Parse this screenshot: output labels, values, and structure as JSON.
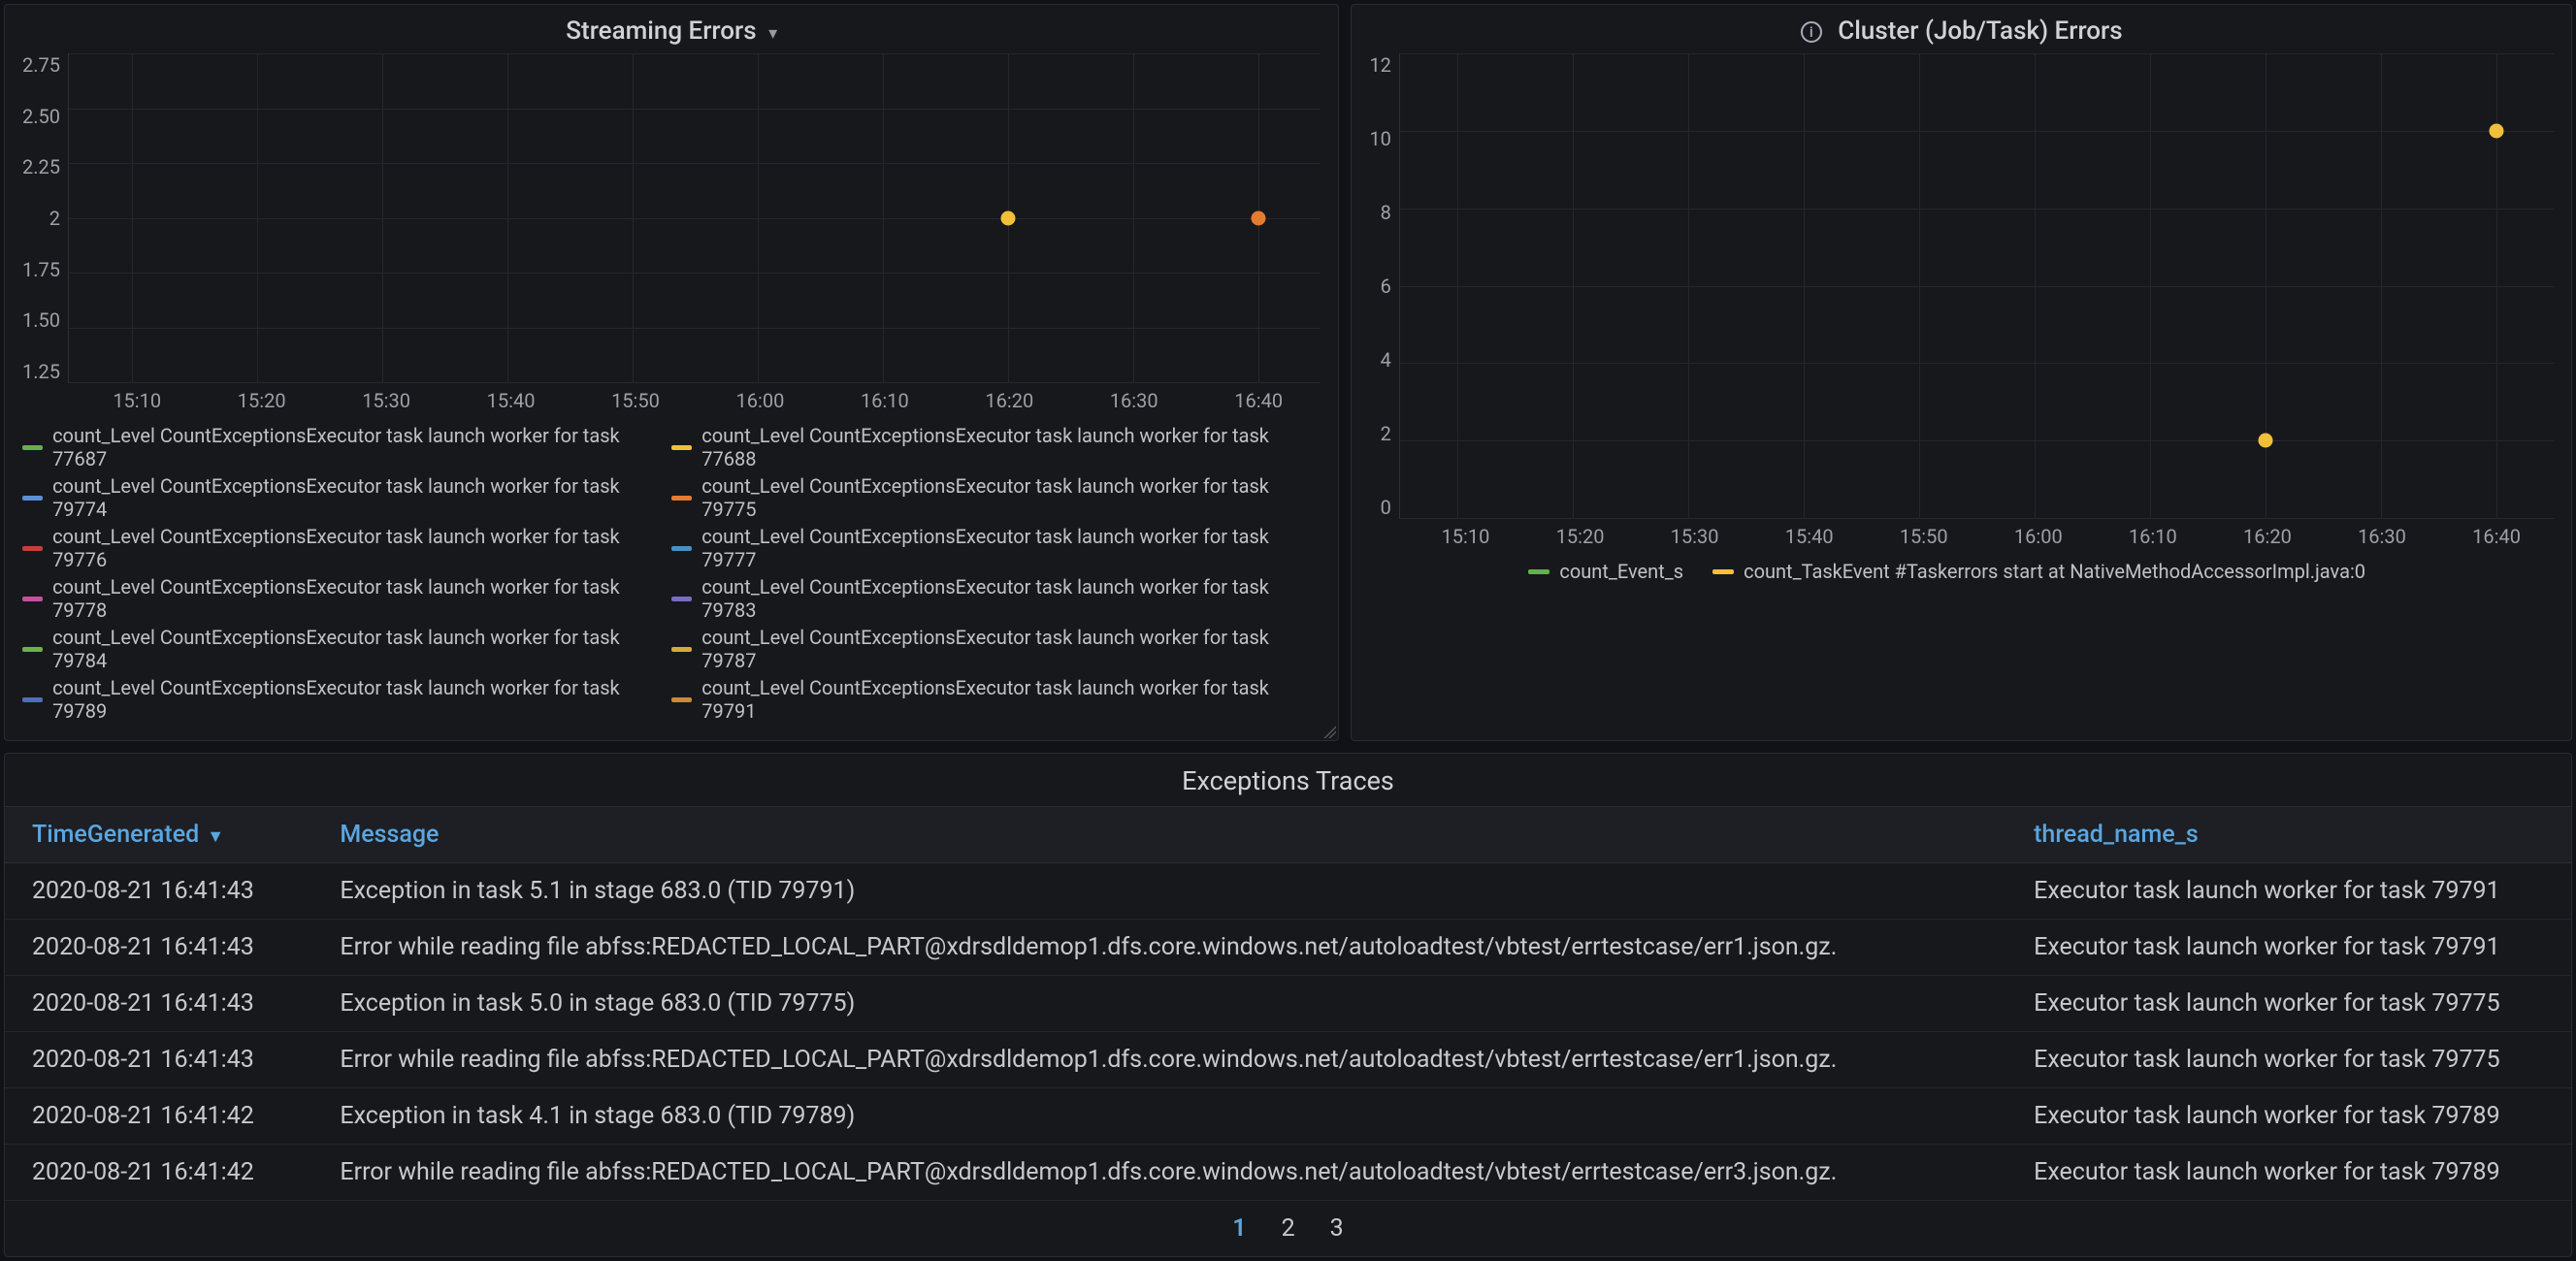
{
  "chart_data": [
    {
      "id": "streaming",
      "type": "scatter",
      "title": "Streaming Errors",
      "xlabel": "",
      "ylabel": "",
      "ylim": [
        1.25,
        2.75
      ],
      "yticks": [
        1.25,
        1.5,
        1.75,
        2.0,
        2.25,
        2.5,
        2.75
      ],
      "xticks": [
        "15:10",
        "15:20",
        "15:30",
        "15:40",
        "15:50",
        "16:00",
        "16:10",
        "16:20",
        "16:30",
        "16:40"
      ],
      "points": [
        {
          "x": "16:20",
          "y": 2.0,
          "color": "#f2c038"
        },
        {
          "x": "16:40",
          "y": 2.0,
          "color": "#e57b2f"
        }
      ],
      "series": [
        {
          "name": "count_Level CountExceptionsExecutor task launch worker for task 77687",
          "color": "#62b14a"
        },
        {
          "name": "count_Level CountExceptionsExecutor task launch worker for task 77688",
          "color": "#f2c038"
        },
        {
          "name": "count_Level CountExceptionsExecutor task launch worker for task 79774",
          "color": "#5a8fd6"
        },
        {
          "name": "count_Level CountExceptionsExecutor task launch worker for task 79775",
          "color": "#e57b2f"
        },
        {
          "name": "count_Level CountExceptionsExecutor task launch worker for task 79776",
          "color": "#c23f3f"
        },
        {
          "name": "count_Level CountExceptionsExecutor task launch worker for task 79777",
          "color": "#4a90c2"
        },
        {
          "name": "count_Level CountExceptionsExecutor task launch worker for task 79778",
          "color": "#c64fa0"
        },
        {
          "name": "count_Level CountExceptionsExecutor task launch worker for task 79783",
          "color": "#7a6cc4"
        },
        {
          "name": "count_Level CountExceptionsExecutor task launch worker for task 79784",
          "color": "#6fb04a"
        },
        {
          "name": "count_Level CountExceptionsExecutor task launch worker for task 79787",
          "color": "#d6a93a"
        },
        {
          "name": "count_Level CountExceptionsExecutor task launch worker for task 79789",
          "color": "#4f6fb5"
        },
        {
          "name": "count_Level CountExceptionsExecutor task launch worker for task 79791",
          "color": "#c98a3a"
        }
      ]
    },
    {
      "id": "cluster",
      "type": "scatter",
      "title": "Cluster (Job/Task) Errors",
      "xlabel": "",
      "ylabel": "",
      "ylim": [
        0,
        12
      ],
      "yticks": [
        0,
        2,
        4,
        6,
        8,
        10,
        12
      ],
      "xticks": [
        "15:10",
        "15:20",
        "15:30",
        "15:40",
        "15:50",
        "16:00",
        "16:10",
        "16:20",
        "16:30",
        "16:40"
      ],
      "points": [
        {
          "x": "16:20",
          "y": 2,
          "color": "#f2c038"
        },
        {
          "x": "16:40",
          "y": 10,
          "color": "#f2c038"
        }
      ],
      "series": [
        {
          "name": "count_Event_s",
          "color": "#62b14a"
        },
        {
          "name": "count_TaskEvent #Taskerrors start at NativeMethodAccessorImpl.java:0",
          "color": "#f2c038"
        }
      ]
    }
  ],
  "table": {
    "title": "Exceptions Traces",
    "columns": [
      "TimeGenerated",
      "Message",
      "thread_name_s"
    ],
    "sort_col": "TimeGenerated",
    "sort_dir": "desc",
    "rows": [
      {
        "TimeGenerated": "2020-08-21 16:41:43",
        "Message": "Exception in task 5.1 in stage 683.0 (TID 79791)",
        "thread_name_s": "Executor task launch worker for task 79791"
      },
      {
        "TimeGenerated": "2020-08-21 16:41:43",
        "Message": "Error while reading file abfss:REDACTED_LOCAL_PART@xdrsdldemop1.dfs.core.windows.net/autoloadtest/vbtest/errtestcase/err1.json.gz.",
        "thread_name_s": "Executor task launch worker for task 79791"
      },
      {
        "TimeGenerated": "2020-08-21 16:41:43",
        "Message": "Exception in task 5.0 in stage 683.0 (TID 79775)",
        "thread_name_s": "Executor task launch worker for task 79775"
      },
      {
        "TimeGenerated": "2020-08-21 16:41:43",
        "Message": "Error while reading file abfss:REDACTED_LOCAL_PART@xdrsdldemop1.dfs.core.windows.net/autoloadtest/vbtest/errtestcase/err1.json.gz.",
        "thread_name_s": "Executor task launch worker for task 79775"
      },
      {
        "TimeGenerated": "2020-08-21 16:41:42",
        "Message": "Exception in task 4.1 in stage 683.0 (TID 79789)",
        "thread_name_s": "Executor task launch worker for task 79789"
      },
      {
        "TimeGenerated": "2020-08-21 16:41:42",
        "Message": "Error while reading file abfss:REDACTED_LOCAL_PART@xdrsdldemop1.dfs.core.windows.net/autoloadtest/vbtest/errtestcase/err3.json.gz.",
        "thread_name_s": "Executor task launch worker for task 79789"
      }
    ],
    "pages": [
      "1",
      "2",
      "3"
    ],
    "active_page": "1"
  }
}
